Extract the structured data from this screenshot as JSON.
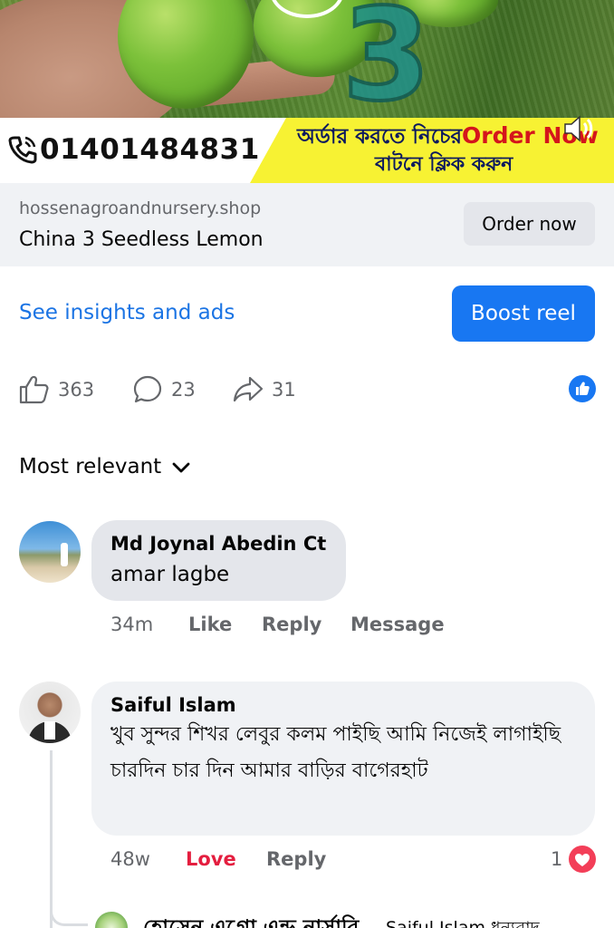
{
  "video_banner": {
    "overlay_number": "3",
    "phone_number": "01401484831",
    "promo_line1_bn": "অর্ডার করতে নিচের",
    "promo_line1_en": "Order Now",
    "promo_line2_bn": "বাটনে ক্লিক করুন"
  },
  "link_card": {
    "domain": "hossenagroandnursery.shop",
    "title": "China 3 Seedless Lemon",
    "cta_label": "Order now"
  },
  "actions": {
    "insights_label": "See insights and ads",
    "boost_label": "Boost reel"
  },
  "stats": {
    "likes": "363",
    "comments": "23",
    "shares": "31"
  },
  "comments_section": {
    "sort_label": "Most relevant",
    "comments": [
      {
        "author": "Md Joynal Abedin Ct",
        "text": "amar lagbe",
        "time": "34m",
        "like_label": "Like",
        "reply_label": "Reply",
        "message_label": "Message"
      },
      {
        "author": "Saiful Islam",
        "text": "খুব সুন্দর শিখর লেবুর কলম পাইছি আমি নিজেই লাগাইছি চারদিন  চার দিন আমার বাড়ির বাগেরহাট",
        "time": "48w",
        "love_label": "Love",
        "reply_label": "Reply",
        "reaction_count": "1"
      }
    ],
    "reply_preview": {
      "author": "হোসেন এগ্রো এন্ড নার্সারি",
      "text": "Saiful Islam ধন্যবাদ"
    }
  },
  "colors": {
    "primary_blue": "#1877f2",
    "link_blue": "#1b74e4",
    "love_red": "#e41e3f",
    "banner_yellow": "#f7f233",
    "promo_red": "#d4151c"
  }
}
